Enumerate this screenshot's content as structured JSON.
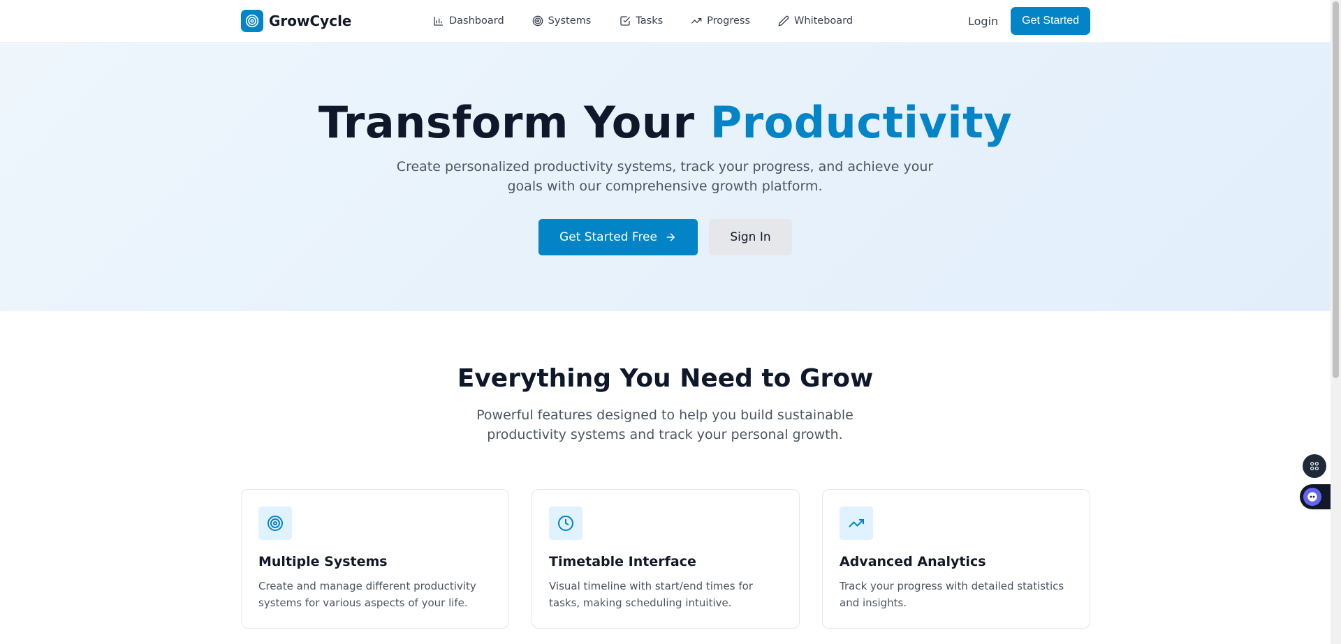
{
  "nav": {
    "brand": "GrowCycle",
    "links": [
      {
        "label": "Dashboard",
        "icon": "bar-chart-icon"
      },
      {
        "label": "Systems",
        "icon": "target-icon"
      },
      {
        "label": "Tasks",
        "icon": "checkbox-icon"
      },
      {
        "label": "Progress",
        "icon": "trending-up-icon"
      },
      {
        "label": "Whiteboard",
        "icon": "pencil-icon"
      }
    ],
    "login": "Login",
    "cta": "Get Started"
  },
  "hero": {
    "title_main": "Transform Your ",
    "title_accent": "Productivity",
    "subtitle": "Create personalized productivity systems, track your progress, and achieve your goals with our comprehensive growth platform.",
    "primary_button": "Get Started Free",
    "secondary_button": "Sign In"
  },
  "features": {
    "title": "Everything You Need to Grow",
    "subtitle": "Powerful features designed to help you build sustainable productivity systems and track your personal growth.",
    "cards": [
      {
        "icon": "target-icon",
        "title": "Multiple Systems",
        "description": "Create and manage different productivity systems for various aspects of your life."
      },
      {
        "icon": "clock-icon",
        "title": "Timetable Interface",
        "description": "Visual timeline with start/end times for tasks, making scheduling intuitive."
      },
      {
        "icon": "trending-up-icon",
        "title": "Advanced Analytics",
        "description": "Track your progress with detailed statistics and insights."
      }
    ]
  },
  "colors": {
    "accent": "#0284c7",
    "heading": "#0f172a",
    "body_text": "#4b5563",
    "hero_bg": "#e8f3fc"
  }
}
